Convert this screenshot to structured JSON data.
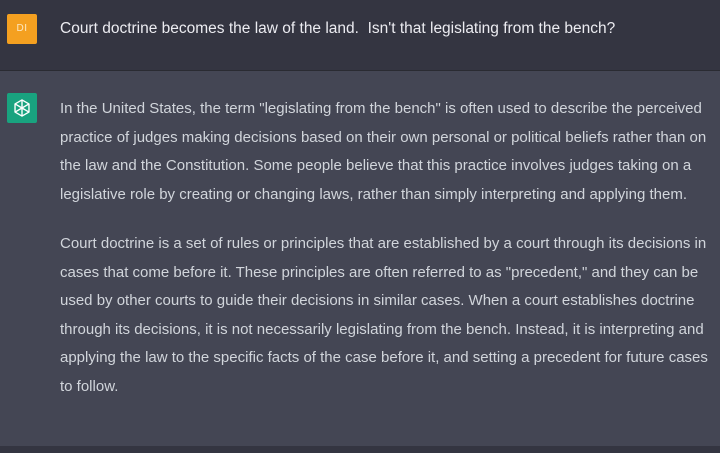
{
  "user": {
    "avatar_initials": "DI",
    "message": "Court doctrine becomes the law of the land.  Isn't that legislating from the bench?"
  },
  "assistant": {
    "avatar_icon": "openai-logo-icon",
    "paragraphs": [
      "In the United States, the term \"legislating from the bench\" is often used to describe the perceived practice of judges making decisions based on their own personal or political beliefs rather than on the law and the Constitution. Some people believe that this practice involves judges taking on a legislative role by creating or changing laws, rather than simply interpreting and applying them.",
      "Court doctrine is a set of rules or principles that are established by a court through its decisions in cases that come before it. These principles are often referred to as \"precedent,\" and they can be used by other courts to guide their decisions in similar cases. When a court establishes doctrine through its decisions, it is not necessarily legislating from the bench. Instead, it is interpreting and applying the law to the specific facts of the case before it, and setting a precedent for future cases to follow."
    ]
  },
  "colors": {
    "user_bg": "#343541",
    "assistant_bg": "#444654",
    "user_avatar": "#f4a020",
    "assistant_avatar": "#19a37f"
  }
}
